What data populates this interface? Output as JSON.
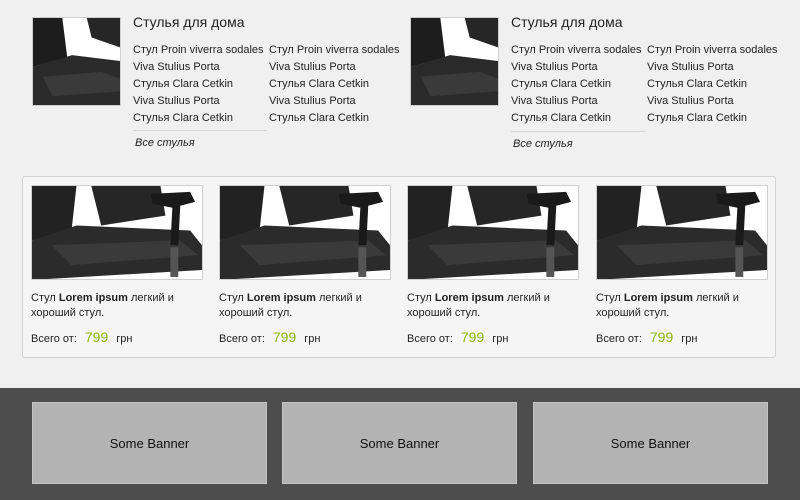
{
  "categories": [
    {
      "title": "Стулья для дома",
      "links_col1": [
        "Стул Proin viverra sodales",
        "Viva Stulius Porta",
        "Стулья Clara Cetkin",
        "Viva Stulius Porta",
        "Стулья Clara Cetkin"
      ],
      "links_col2": [
        "Стул Proin viverra sodales",
        "Viva Stulius Porta",
        "Стулья Clara Cetkin",
        "Viva Stulius Porta",
        "Стулья Clara Cetkin"
      ],
      "all_label": "Все стулья"
    },
    {
      "title": "Стулья для дома",
      "links_col1": [
        "Стул Proin viverra sodales",
        "Viva Stulius Porta",
        "Стулья Clara Cetkin",
        "Viva Stulius Porta",
        "Стулья Clara Cetkin"
      ],
      "links_col2": [
        "Стул Proin viverra sodales",
        "Viva Stulius Porta",
        "Стулья Clara Cetkin",
        "Viva Stulius Porta",
        "Стулья Clara Cetkin"
      ],
      "all_label": "Все стулья"
    }
  ],
  "products": [
    {
      "prefix": "Стул",
      "bold": "Lorem ipsum",
      "suffix": "легкий и хороший стул.",
      "price_label": "Всего от:",
      "price": "799",
      "currency": "грн"
    },
    {
      "prefix": "Стул",
      "bold": "Lorem ipsum",
      "suffix": "легкий и хороший стул.",
      "price_label": "Всего от:",
      "price": "799",
      "currency": "грн"
    },
    {
      "prefix": "Стул",
      "bold": "Lorem ipsum",
      "suffix": "легкий и хороший стул.",
      "price_label": "Всего от:",
      "price": "799",
      "currency": "грн"
    },
    {
      "prefix": "Стул",
      "bold": "Lorem ipsum",
      "suffix": "легкий и хороший стул.",
      "price_label": "Всего от:",
      "price": "799",
      "currency": "грн"
    }
  ],
  "banners": [
    "Some Banner",
    "Some Banner",
    "Some Banner"
  ],
  "colors": {
    "price": "#8db31a",
    "footer": "#4d4d4d",
    "banner": "#b3b3b3"
  },
  "images": {
    "category_thumb": "chair-photo",
    "product_image": "chair-photo"
  }
}
